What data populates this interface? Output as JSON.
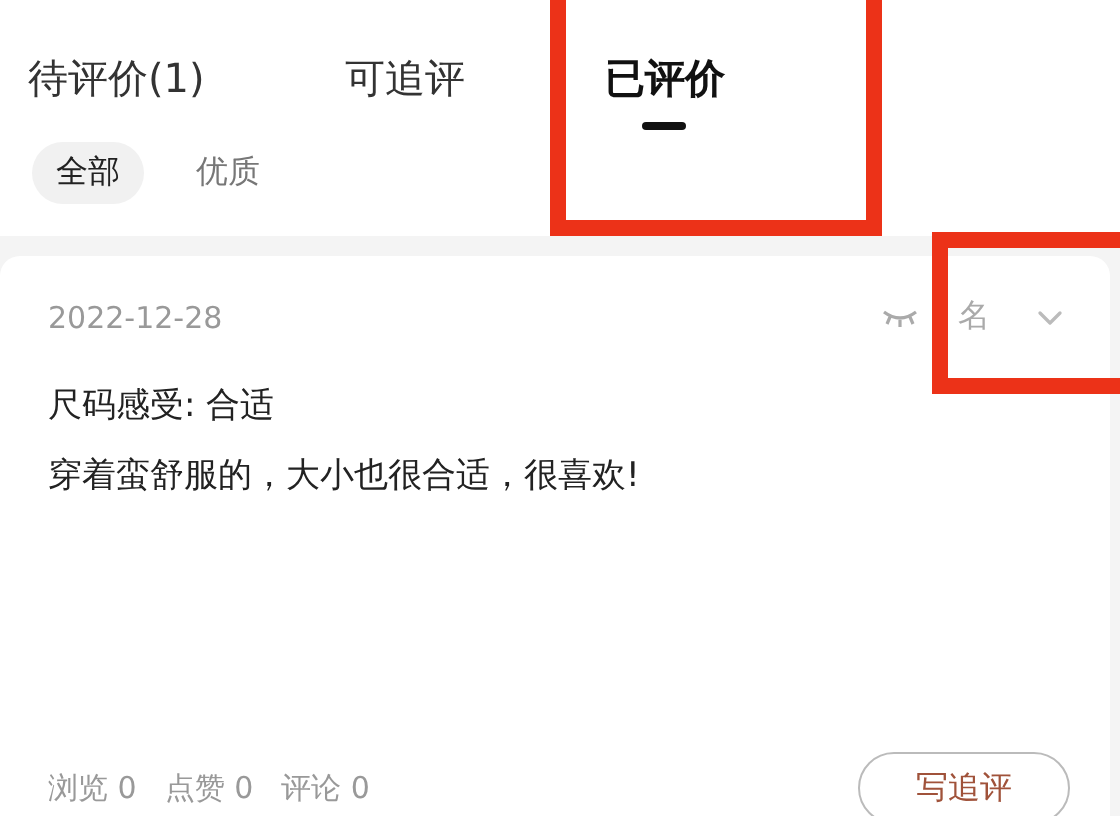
{
  "tabs": [
    {
      "label": "待评价(1)",
      "selected": false
    },
    {
      "label": "可追评",
      "selected": false
    },
    {
      "label": "已评价",
      "selected": true,
      "highlighted": true
    }
  ],
  "filters": [
    {
      "label": "全部",
      "selected": true
    },
    {
      "label": "优质",
      "selected": false
    }
  ],
  "review": {
    "date": "2022-12-28",
    "anonymous_label": "名",
    "anonymous_highlighted": true,
    "lines": [
      "尺码感受: 合适",
      "穿着蛮舒服的，大小也很合适，很喜欢!"
    ],
    "stats": [
      "浏览 0",
      "点赞 0",
      "评论 0"
    ],
    "button": "写追评"
  }
}
